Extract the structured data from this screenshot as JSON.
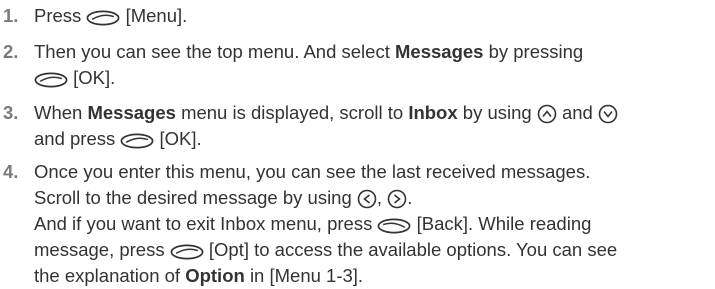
{
  "steps": [
    {
      "number": "1.",
      "p1": "Press",
      "key": "[Menu]",
      "tail": "."
    },
    {
      "number": "2.",
      "p1": "Then you can see the top menu. And select",
      "b1": "Messages",
      "p2": "by pressing",
      "key": "[OK]."
    },
    {
      "number": "3.",
      "p1": "When",
      "b1": "Messages",
      "p2": "menu is displayed, scroll to",
      "b2": "Inbox",
      "p3": "by using",
      "p4": "and",
      "p5": "and press",
      "key": "[OK]."
    },
    {
      "number": "4.",
      "line1": "Once you enter this menu, you can see the last received messages.",
      "line2": "Scroll to the desired message by using",
      "sep": ",",
      "line2_end": ".",
      "line3a": "And if you want to exit Inbox menu, press",
      "line3b": "[Back]. While reading",
      "line4a": "message, press",
      "line4b": "[Opt] to access the available options. You can see",
      "line5a": "the explanation of",
      "line5b": "Option",
      "line5c": "in [Menu 1-3]."
    }
  ],
  "icons": {
    "soft_key": "left-soft-key-icon",
    "right_soft_key": "right-soft-key-icon",
    "up": "nav-up-icon",
    "down": "nav-down-icon",
    "left": "nav-left-icon",
    "right": "nav-right-icon"
  },
  "colors": {
    "number": "#7a7a7a",
    "text": "#333333"
  }
}
